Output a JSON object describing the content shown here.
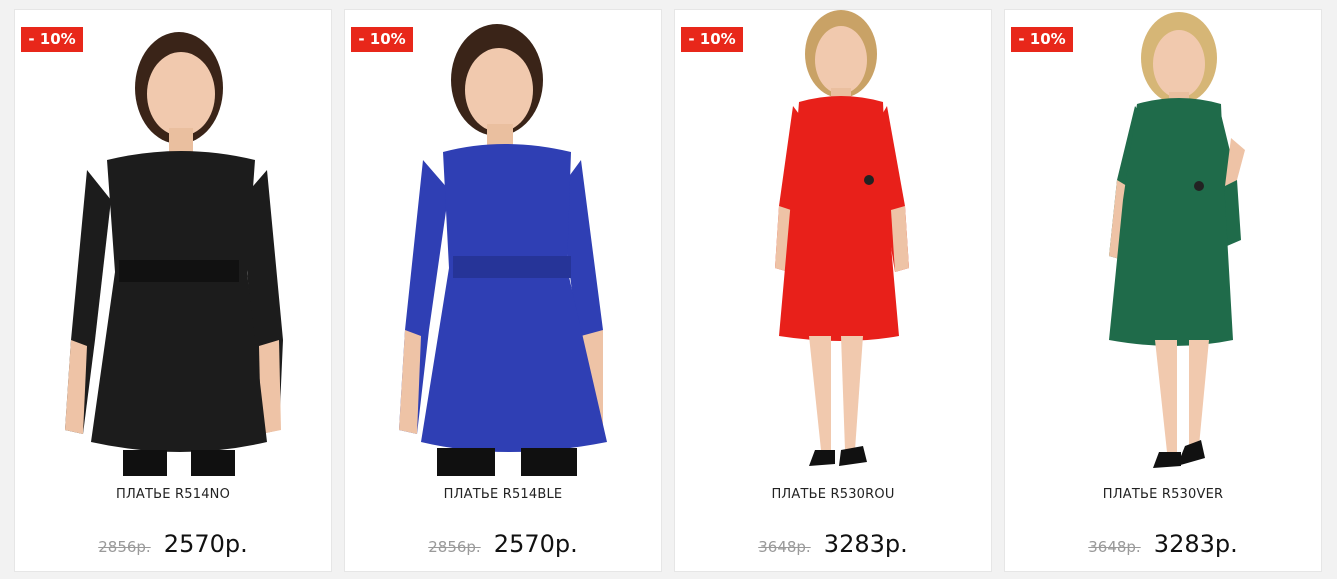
{
  "products": [
    {
      "badge": "- 10%",
      "name": "ПЛАТЬЕ R514NO",
      "old_price": "2856р.",
      "new_price": "2570р.",
      "dress_color": "#1c1c1c",
      "hair_color": "#3a2418"
    },
    {
      "badge": "- 10%",
      "name": "ПЛАТЬЕ R514BLE",
      "old_price": "2856р.",
      "new_price": "2570р.",
      "dress_color": "#2f3fb4",
      "hair_color": "#3a2418"
    },
    {
      "badge": "- 10%",
      "name": "ПЛАТЬЕ R530ROU",
      "old_price": "3648р.",
      "new_price": "3283р.",
      "dress_color": "#e8201a",
      "hair_color": "#c9a266"
    },
    {
      "badge": "- 10%",
      "name": "ПЛАТЬЕ R530VER",
      "old_price": "3648р.",
      "new_price": "3283р.",
      "dress_color": "#1f6b4a",
      "hair_color": "#d6b676"
    }
  ],
  "colors": {
    "badge_bg": "#e8271a",
    "card_bg": "#ffffff",
    "page_bg": "#f2f2f2"
  }
}
